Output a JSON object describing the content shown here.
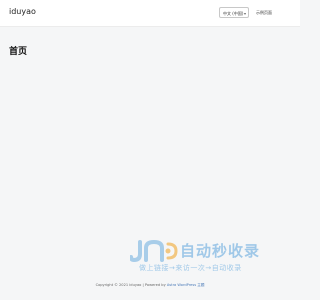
{
  "header": {
    "site_title": "iduyao",
    "language_select": "中文 (中国)",
    "sample_page_link": "示例页面"
  },
  "main": {
    "page_title": "首页"
  },
  "watermark": {
    "title": "自动秒收录",
    "subtitle": "做上链接→来访一次→自动收录"
  },
  "footer": {
    "copyright": "Copyright © 2021 iduyao",
    "separator": " | Powered by ",
    "theme_link": "Astra WordPress 主题"
  },
  "colors": {
    "background": "#f5f6f7",
    "header_bg": "#ffffff",
    "watermark": "#5ba4dc",
    "link": "#4a7ab8"
  }
}
